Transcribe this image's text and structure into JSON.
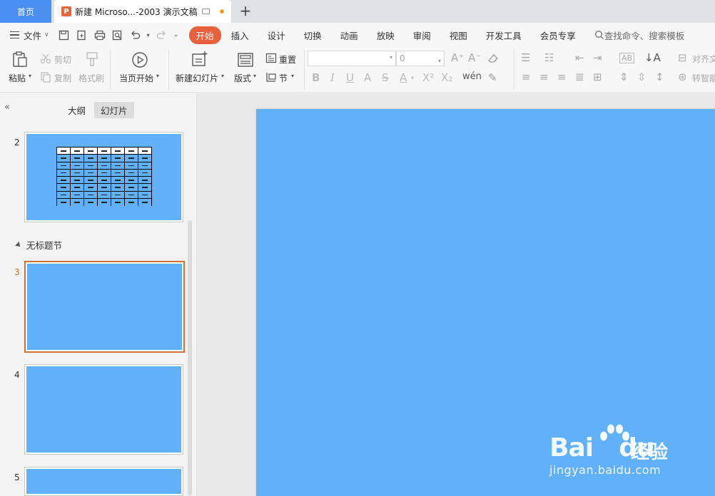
{
  "tabs": {
    "home": "首页",
    "doc_title": "新建 Microso...-2003 演示文稿",
    "new_tab": "+"
  },
  "menu": {
    "file": "文件",
    "tabs": [
      "开始",
      "插入",
      "设计",
      "切换",
      "动画",
      "放映",
      "审阅",
      "视图",
      "开发工具",
      "会员专享"
    ],
    "active_tab": "开始",
    "search": "查找命令、搜索模板"
  },
  "ribbon": {
    "paste": "粘贴",
    "cut": "剪切",
    "copy": "复制",
    "format_painter": "格式刷",
    "play_from_current": "当页开始",
    "new_slide": "新建幻灯片",
    "layout": "版式",
    "reset": "重置",
    "section": "节",
    "font_size": "0",
    "align": "对齐文",
    "convert_smart": "转智能"
  },
  "left_panel": {
    "tab_outline": "大纲",
    "tab_slides": "幻灯片",
    "active": "幻灯片",
    "section_label": "无标题节",
    "slides": [
      {
        "num": "2",
        "selected": false,
        "has_table": true
      },
      {
        "num": "3",
        "selected": true,
        "has_table": false
      },
      {
        "num": "4",
        "selected": false,
        "has_table": false
      },
      {
        "num": "5",
        "selected": false,
        "has_table": false
      }
    ]
  },
  "watermark": {
    "brand": "Bai",
    "brand2": "du",
    "cn": "经验",
    "url": "jingyan.baidu.com"
  },
  "colors": {
    "slide_bg": "#60b0fa",
    "accent": "#e8613c",
    "home_tab": "#4a8ff0"
  }
}
